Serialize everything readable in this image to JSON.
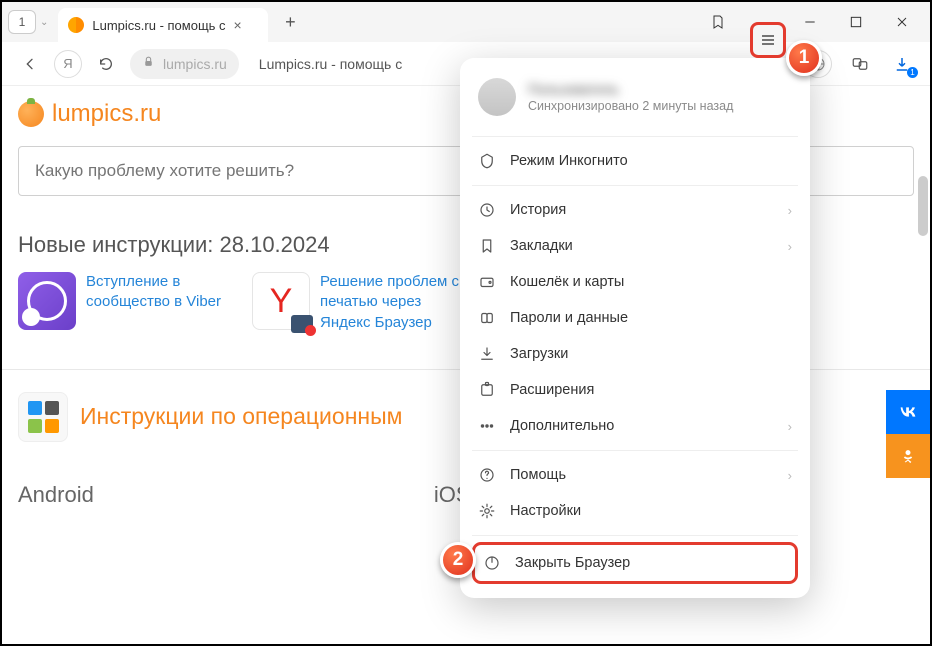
{
  "tab": {
    "count": "1",
    "title": "Lumpics.ru - помощь с"
  },
  "url": {
    "domain": "lumpics.ru",
    "rest": "Lumpics.ru - помощь с"
  },
  "site": {
    "name": "lumpics.ru"
  },
  "search": {
    "placeholder": "Какую проблему хотите решить?"
  },
  "section": {
    "new_title": "Новые инструкции: 28.10.2024"
  },
  "articles": [
    {
      "title": "Вступление в сообщество в Viber"
    },
    {
      "title": "Решение проблем с печатью через Яндекс Браузер"
    }
  ],
  "os_section": {
    "title": "Инструкции по операционным"
  },
  "platforms": {
    "android": "Android",
    "ios": "iOS (iPhone, iPad)"
  },
  "download_badge": "1",
  "menu": {
    "user_name": "Пользователь",
    "sync_status": "Синхронизировано 2 минуты назад",
    "incognito": "Режим Инкогнито",
    "history": "История",
    "bookmarks": "Закладки",
    "wallet": "Кошелёк и карты",
    "passwords": "Пароли и данные",
    "downloads": "Загрузки",
    "extensions": "Расширения",
    "more": "Дополнительно",
    "help": "Помощь",
    "settings": "Настройки",
    "close": "Закрыть Браузер"
  },
  "callouts": {
    "one": "1",
    "two": "2"
  }
}
